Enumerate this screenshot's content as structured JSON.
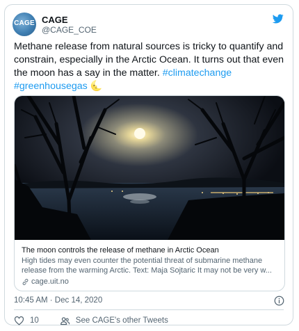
{
  "tweet": {
    "author": {
      "display_name": "CAGE",
      "handle": "@CAGE_COE",
      "avatar_text": "CAGE"
    },
    "body": {
      "text": "Methane release from natural sources is tricky to quantify and constrain, especially in the Arctic Ocean. It turns out that even the moon has a say in the matter. ",
      "hashtags": [
        "#climatechange",
        "#greenhousegas"
      ],
      "emoji": "🌜"
    },
    "link_card": {
      "title": "The moon controls the release of methane in Arctic Ocean",
      "description": "High tides may even counter the potential threat of submarine methane release from the warming Arctic. Text: Maja Sojtaric It may not be very w...",
      "domain": "cage.uit.no"
    },
    "timestamp": "10:45 AM · Dec 14, 2020",
    "like_count": "10",
    "other_tweets_label": "See CAGE's other Tweets",
    "colors": {
      "accent": "#1d9bf0",
      "text": "#0f1419",
      "muted": "#536471",
      "border": "#cfd9de",
      "like": "#f91880"
    },
    "icons": {
      "brand": "twitter-bird-icon",
      "info": "info-icon",
      "like": "heart-icon",
      "profile": "people-icon",
      "link": "link-icon"
    }
  }
}
